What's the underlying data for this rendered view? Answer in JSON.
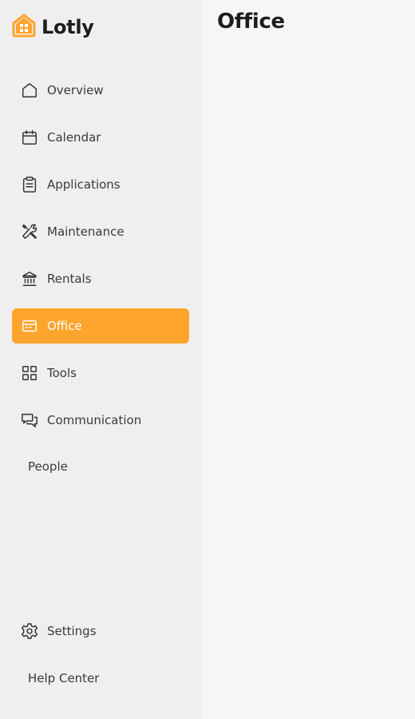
{
  "brand": {
    "name": "Lotly",
    "accent_color": "#ffa42c",
    "logo_icon": "house-icon"
  },
  "sidebar": {
    "items": [
      {
        "label": "Overview",
        "icon": "home-icon"
      },
      {
        "label": "Calendar",
        "icon": "calendar-icon"
      },
      {
        "label": "Applications",
        "icon": "clipboard-icon"
      },
      {
        "label": "Maintenance",
        "icon": "tools-icon"
      },
      {
        "label": "Rentals",
        "icon": "bank-icon"
      },
      {
        "label": "Office",
        "icon": "card-icon",
        "active": true
      },
      {
        "label": "Tools",
        "icon": "grid-icon"
      },
      {
        "label": "Communication",
        "icon": "chat-icon"
      },
      {
        "label": "People",
        "icon": ""
      }
    ],
    "bottom_items": [
      {
        "label": "Settings",
        "icon": "gear-icon"
      },
      {
        "label": "Help Center",
        "icon": ""
      }
    ]
  },
  "main": {
    "title": "Office"
  }
}
